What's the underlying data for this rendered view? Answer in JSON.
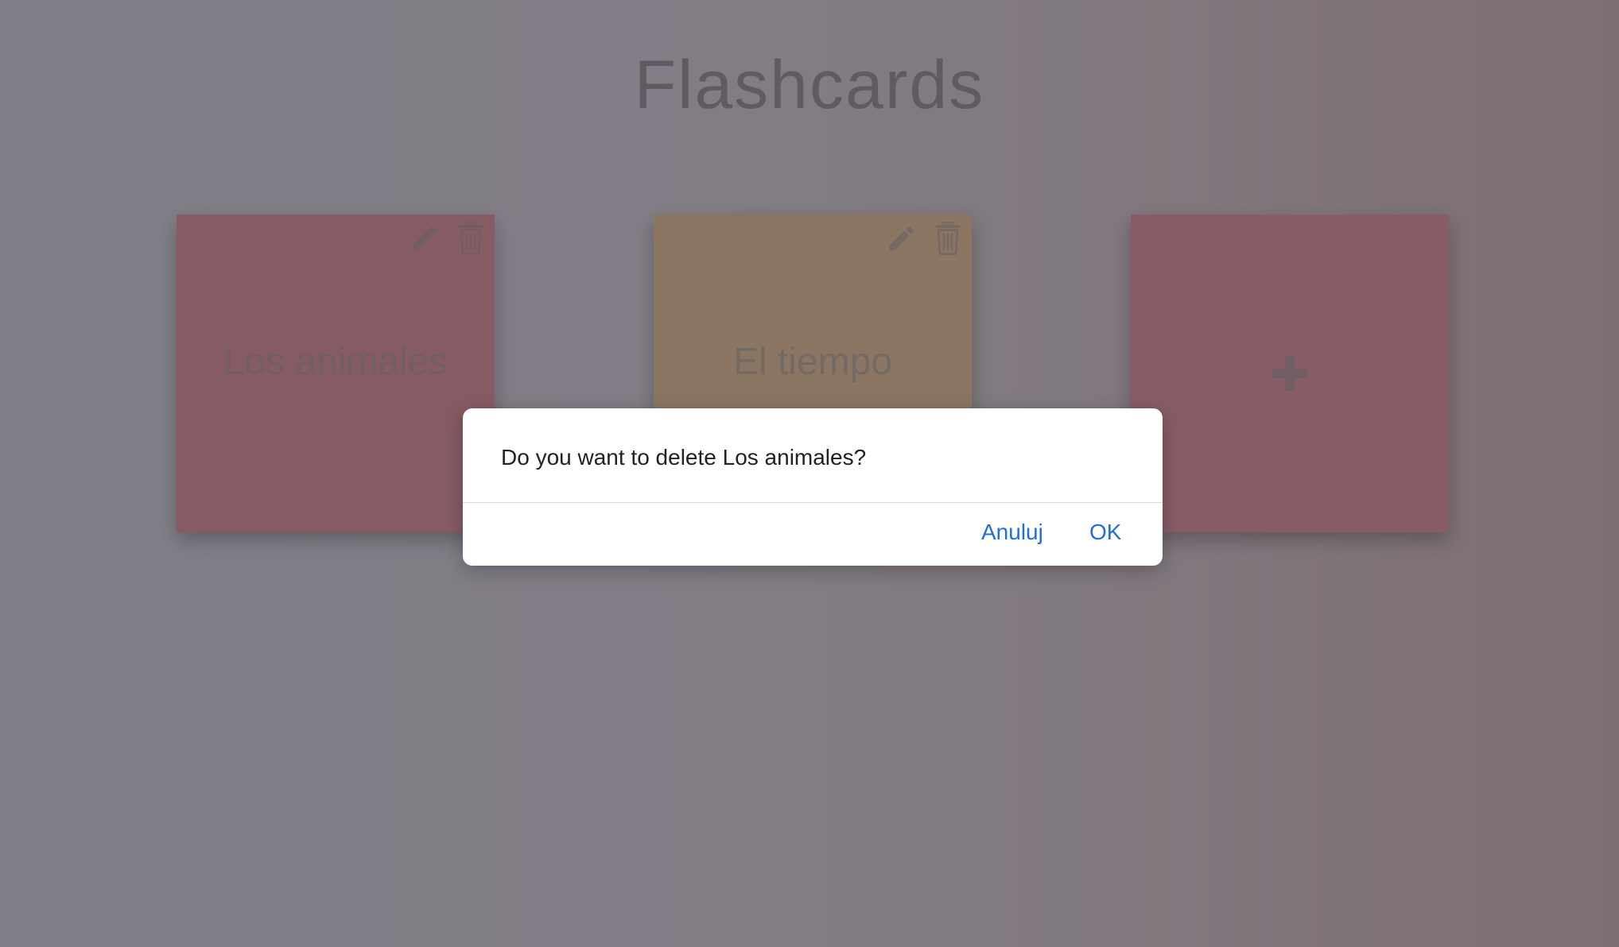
{
  "header": {
    "title": "Flashcards"
  },
  "decks": [
    {
      "title": "Los animales",
      "color": "#f5a3aa",
      "edit_icon": "pencil-icon",
      "delete_icon": "trash-icon"
    },
    {
      "title": "El tiempo",
      "color": "#fbd8a6",
      "edit_icon": "pencil-icon",
      "delete_icon": "trash-icon"
    }
  ],
  "add_card": {
    "icon": "plus-icon",
    "color": "#f4a4ac"
  },
  "dialog": {
    "message": "Do you want to delete Los animales?",
    "cancel_label": "Anuluj",
    "ok_label": "OK",
    "accent_color": "#1f6fd6"
  }
}
